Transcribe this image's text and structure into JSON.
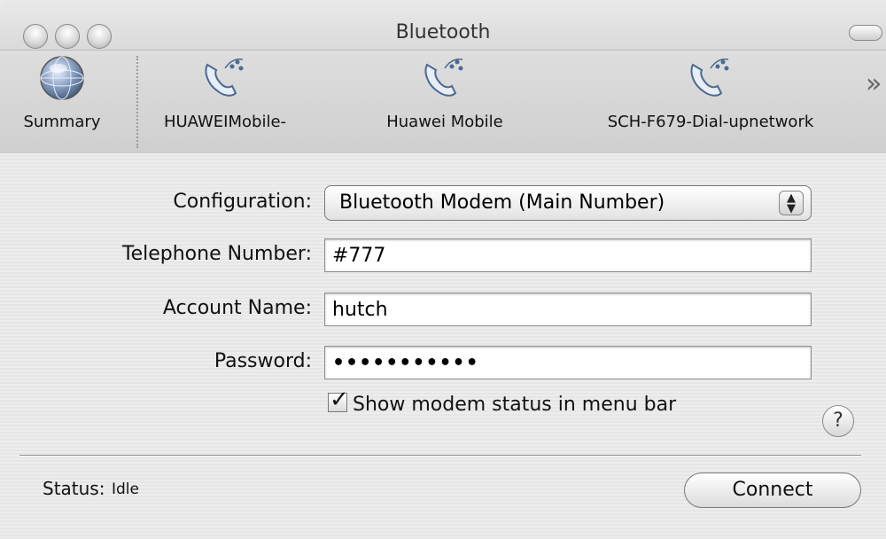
{
  "window": {
    "title": "Bluetooth"
  },
  "toolbar": {
    "items": [
      {
        "label": "Summary",
        "icon": "globe-icon"
      },
      {
        "label": "HUAWEIMobile-",
        "icon": "phone-icon"
      },
      {
        "label": "Huawei Mobile",
        "icon": "phone-icon"
      },
      {
        "label": "SCH-F679-Dial-upnetwork",
        "icon": "phone-icon"
      }
    ],
    "overflow": "»"
  },
  "form": {
    "configuration": {
      "label": "Configuration:",
      "value": "Bluetooth Modem (Main Number)"
    },
    "telephone": {
      "label": "Telephone Number:",
      "value": "#777"
    },
    "account": {
      "label": "Account Name:",
      "value": "hutch"
    },
    "password": {
      "label": "Password:",
      "value": "•••••••••••"
    },
    "show_status": {
      "label": "Show modem status in menu bar",
      "checked": true
    }
  },
  "help": "?",
  "status": {
    "label": "Status:",
    "value": "Idle"
  },
  "connect_label": "Connect"
}
